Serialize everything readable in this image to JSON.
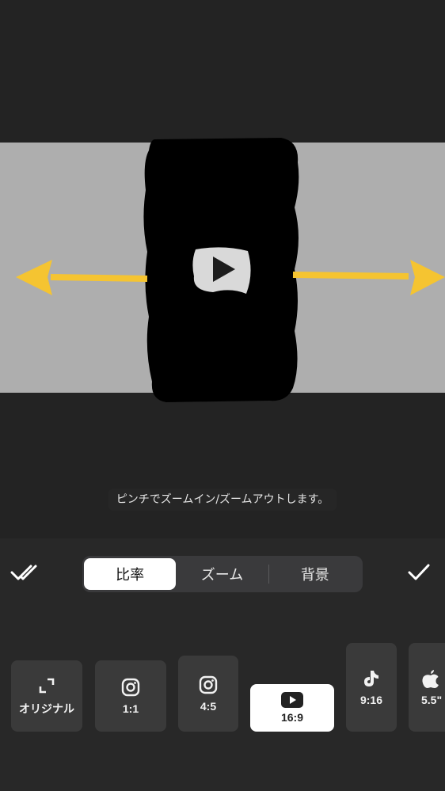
{
  "hint": "ピンチでズームイン/ズームアウトします。",
  "tabs": [
    {
      "label": "比率",
      "active": true
    },
    {
      "label": "ズーム",
      "active": false
    },
    {
      "label": "背景",
      "active": false
    }
  ],
  "ratios": [
    {
      "label": "オリジナル",
      "icon": "expand-icon"
    },
    {
      "label": "1:1",
      "icon": "instagram-icon"
    },
    {
      "label": "4:5",
      "icon": "instagram-icon"
    },
    {
      "label": "16:9",
      "icon": "youtube-icon",
      "selected": true
    },
    {
      "label": "9:16",
      "icon": "tiktok-icon"
    },
    {
      "label": "5.5\"",
      "icon": "apple-icon"
    }
  ],
  "colors": {
    "background": "#232323",
    "canvas": "#aeaeae",
    "arrow": "#f5c431",
    "panel": "#282828"
  }
}
